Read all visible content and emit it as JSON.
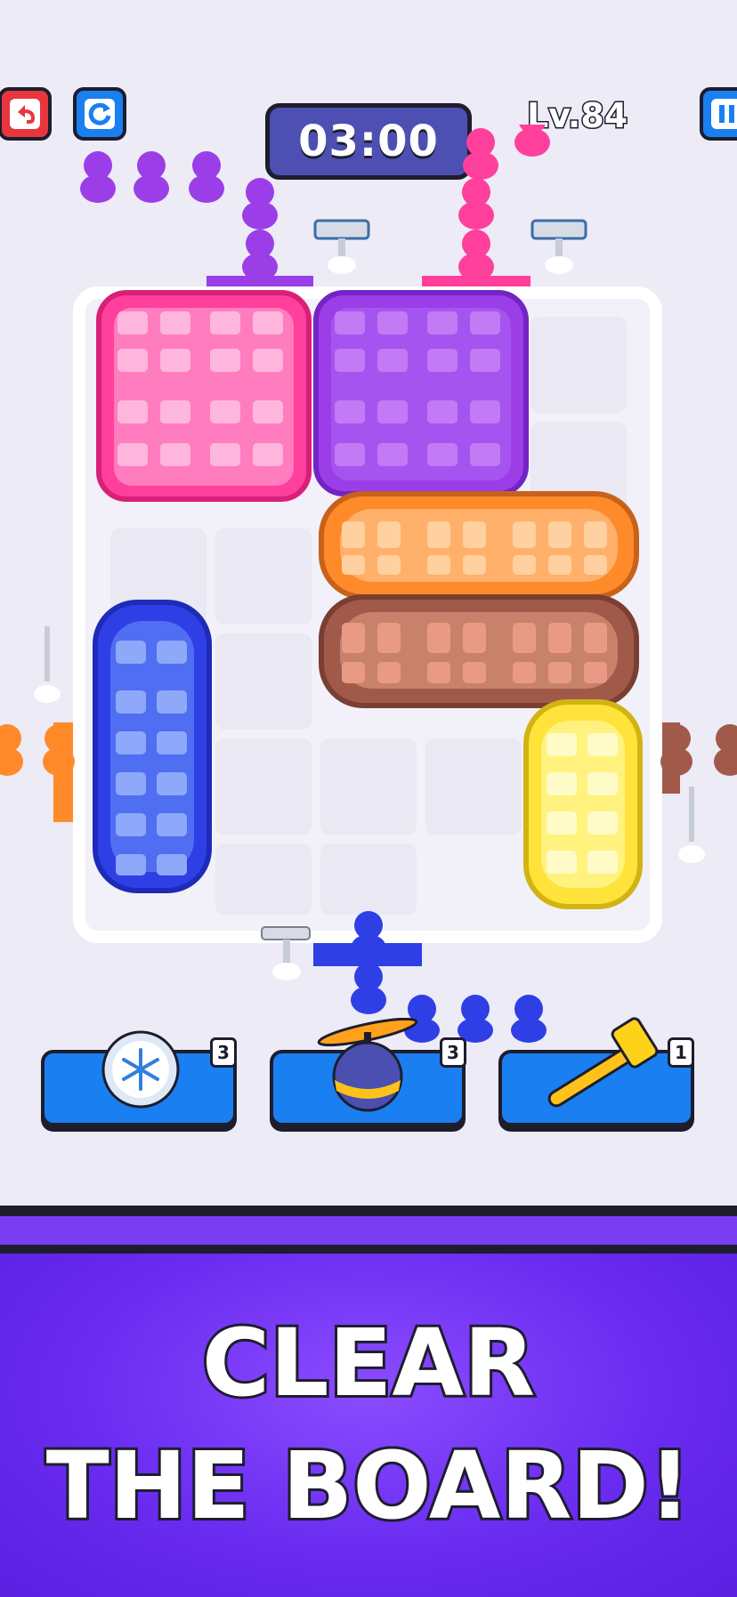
{
  "hud": {
    "timer": "03:00",
    "level": "Lv.84",
    "undo_icon": "undo-icon",
    "restart_icon": "restart-icon",
    "pause_icon": "pause-icon"
  },
  "colors": {
    "pink": "#ff3f9c",
    "purple": "#9b3ee8",
    "orange": "#ff8a2a",
    "brown": "#a15a4a",
    "blue": "#2f3fe6",
    "yellow": "#ffe23a",
    "board": "#ffffff",
    "banner": "#6b2af0"
  },
  "boosters": [
    {
      "name": "freeze",
      "icon": "snowflake-icon",
      "count": "3"
    },
    {
      "name": "propeller",
      "icon": "propeller-ball-icon",
      "count": "3"
    },
    {
      "name": "hammer",
      "icon": "hammer-icon",
      "count": "1"
    }
  ],
  "banner": {
    "line1": "CLEAR",
    "line2": "THE BOARD!"
  }
}
